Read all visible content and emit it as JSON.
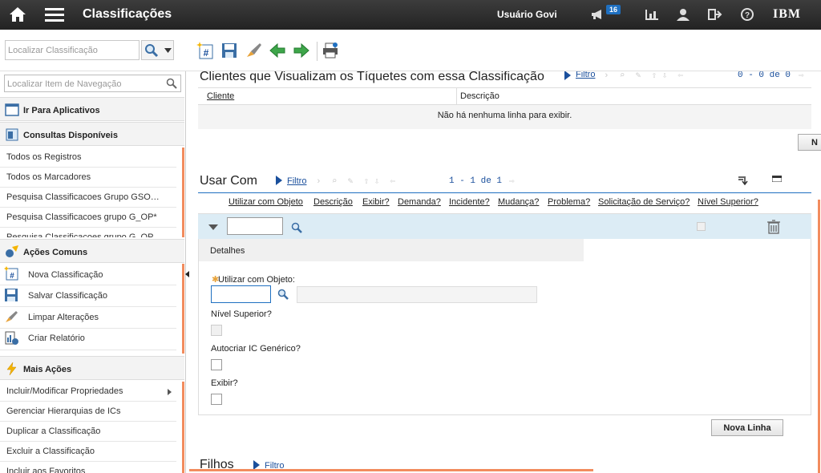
{
  "header": {
    "title": "Classificações",
    "user": "Usuário Govi",
    "notification_count": "16",
    "brand": "IBM"
  },
  "toolbar": {
    "search_placeholder": "Localizar Classificação"
  },
  "sidebar": {
    "search_placeholder": "Localizar Item de Navegação",
    "go_to_apps": "Ir Para Aplicativos",
    "queries_title": "Consultas Disponíveis",
    "queries": [
      "Todos os Registros",
      "Todos os Marcadores",
      "Pesquisa Classificacoes Grupo GSO…",
      "Pesquisa Classificacoes grupo G_OP*",
      "Pesquisa Classificacoes grupo G_OP"
    ],
    "common_title": "Ações Comuns",
    "common": [
      "Nova Classificação",
      "Salvar Classificação",
      "Limpar Alterações",
      "Criar Relatório"
    ],
    "more_title": "Mais Ações",
    "more": [
      "Incluir/Modificar Propriedades",
      "Gerenciar Hierarquias de ICs",
      "Duplicar a Classificação",
      "Excluir a Classificação",
      "Incluir aos Favoritos"
    ]
  },
  "clients": {
    "title": "Clientes que Visualizam os Tíquetes com essa Classificação",
    "filter": "Filtro",
    "pager": "0 - 0 de 0",
    "col_client": "Cliente",
    "col_desc": "Descrição",
    "empty": "Não há nenhuma linha para exibir.",
    "new_btn": "N"
  },
  "usecom": {
    "title": "Usar Com",
    "filter": "Filtro",
    "pager": "1 - 1 de 1",
    "columns": [
      "Utilizar com Objeto",
      "Descrição",
      "Exibir?",
      "Demanda?",
      "Incidente?",
      "Mudança?",
      "Problema?",
      "Solicitação de Serviço?",
      "Nível Superior?"
    ],
    "details_title": "Detalhes",
    "field_object": "Utilizar com Objeto:",
    "field_parent": "Nível Superior?",
    "field_autocreate": "Autocriar IC Genérico?",
    "field_show": "Exibir?",
    "new_row_btn": "Nova Linha"
  },
  "children": {
    "title": "Filhos",
    "filter": "Filtro"
  },
  "colors": {
    "accent": "#f28c5e",
    "link": "#1a4f9c",
    "row_highlight": "#dcecf5"
  }
}
